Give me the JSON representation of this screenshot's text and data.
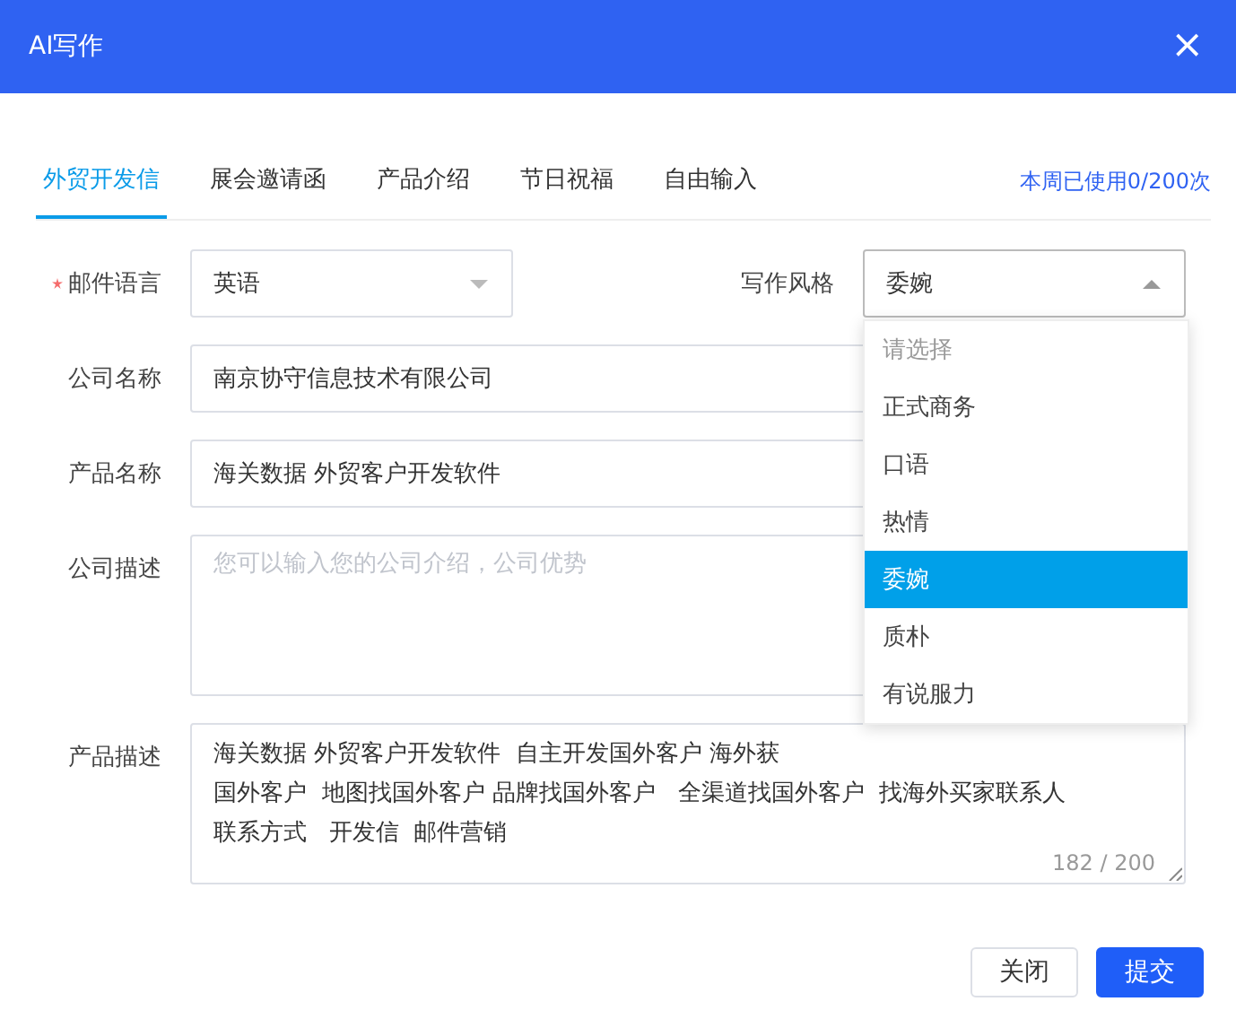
{
  "window": {
    "title": "AI写作",
    "close": "×"
  },
  "tabs": [
    {
      "label": "外贸开发信",
      "selected": true
    },
    {
      "label": "展会邀请函",
      "selected": false
    },
    {
      "label": "产品介绍",
      "selected": false
    },
    {
      "label": "节日祝福",
      "selected": false
    },
    {
      "label": "自由输入",
      "selected": false
    }
  ],
  "usage": "本周已使用0/200次",
  "language": {
    "label": "邮件语言",
    "required": true,
    "value": "英语",
    "expanded": false
  },
  "style": {
    "label": "写作风格",
    "required": false,
    "value": "委婉",
    "expanded": true,
    "options": [
      {
        "label": "请选择",
        "kind": "placeholder",
        "selected": false
      },
      {
        "label": "正式商务",
        "kind": "option",
        "selected": false
      },
      {
        "label": "口语",
        "kind": "option",
        "selected": false
      },
      {
        "label": "热情",
        "kind": "option",
        "selected": false
      },
      {
        "label": "委婉",
        "kind": "option",
        "selected": true
      },
      {
        "label": "质朴",
        "kind": "option",
        "selected": false
      },
      {
        "label": "有说服力",
        "kind": "option",
        "selected": false
      }
    ]
  },
  "fields": [
    {
      "label": "公司名称",
      "kind": "input",
      "value": "南京协守信息技术有限公司"
    },
    {
      "label": "产品名称",
      "kind": "input",
      "value": "海关数据 外贸客户开发软件"
    },
    {
      "label": "公司描述",
      "kind": "textarea",
      "placeholder": "您可以输入您的公司介绍，公司优势"
    },
    {
      "label": "产品描述",
      "kind": "textarea",
      "lines": [
        "海关数据 外贸客户开发软件  自主开发国外客户 海外获",
        "国外客户  地图找国外客户 品牌找国外客户   全渠道找国外客户  找海外买家联系人",
        "联系方式   开发信  邮件营销"
      ],
      "counter": "182 / 200"
    }
  ],
  "buttons": [
    {
      "label": "关闭",
      "kind": "default"
    },
    {
      "label": "提交",
      "kind": "primary"
    }
  ]
}
